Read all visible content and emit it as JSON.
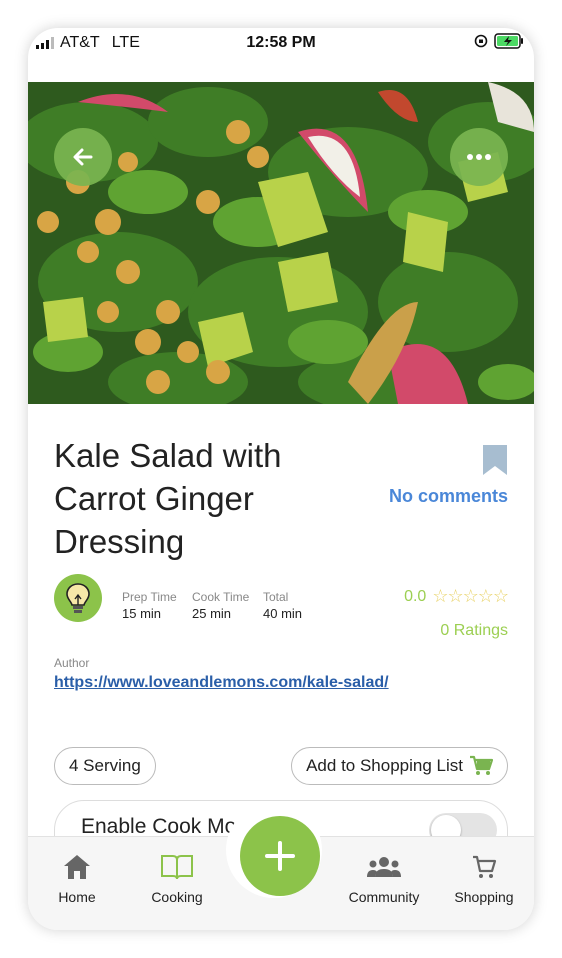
{
  "status_bar": {
    "carrier": "AT&T",
    "network": "LTE",
    "time": "12:58 PM"
  },
  "hero": {
    "back_icon": "arrow-left-icon",
    "more_icon": "more-dots-icon"
  },
  "recipe": {
    "title_lines": [
      "Kale Salad with",
      "Carrot Ginger",
      "Dressing"
    ],
    "comments": "No comments",
    "times": {
      "prep_label": "Prep Time",
      "prep_value": "15 min",
      "cook_label": "Cook Time",
      "cook_value": "25 min",
      "total_label": "Total",
      "total_value": "40 min"
    },
    "rating_value": "0.0",
    "stars": "☆☆☆☆☆",
    "ratings_count": "0 Ratings",
    "author_label": "Author",
    "author_url": "https://www.loveandlemons.com/kale-salad/"
  },
  "actions": {
    "servings": "4 Serving",
    "shopping_list": "Add to Shopping List"
  },
  "cook_mode": {
    "label": "Enable Cook Mo",
    "enabled": false
  },
  "tabbar": {
    "home": "Home",
    "cooking": "Cooking",
    "community": "Community",
    "shopping": "Shopping"
  },
  "colors": {
    "accent_green": "#8cc34a",
    "link_blue": "#4a87d8",
    "star_green": "#9ccf52"
  }
}
